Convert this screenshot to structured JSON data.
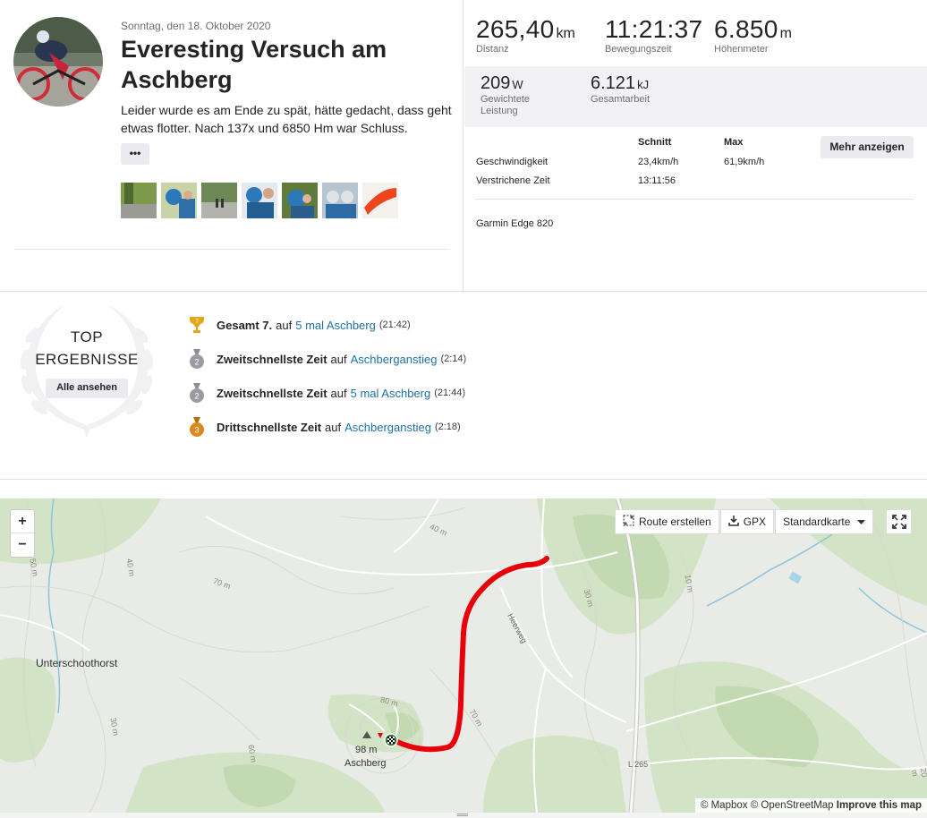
{
  "activity": {
    "date": "Sonntag, den 18. Oktober 2020",
    "title": "Everesting Versuch am Aschberg",
    "description": "Leider wurde es am Ende zu spät, hätte gedacht, dass geht etwas flotter. Nach 137x und 6850 Hm war Schluss.",
    "more_label": "•••",
    "photos": [
      "photo-1",
      "photo-2",
      "photo-3",
      "photo-4",
      "photo-5",
      "photo-6",
      "photo-7"
    ]
  },
  "stats": {
    "primary": [
      {
        "value": "265,40",
        "unit": "km",
        "label": "Distanz"
      },
      {
        "value": "11:21:37",
        "unit": "",
        "label": "Bewegungszeit"
      },
      {
        "value": "6.850",
        "unit": "m",
        "label": "Höhenmeter"
      }
    ],
    "secondary": [
      {
        "value": "209",
        "unit": "W",
        "label_1": "Gewichtete",
        "label_2": "Leistung"
      },
      {
        "value": "6.121",
        "unit": "kJ",
        "label_1": "Gesamtarbeit",
        "label_2": ""
      }
    ],
    "more_button": "Mehr anzeigen",
    "table": {
      "col_avg": "Schnitt",
      "col_max": "Max",
      "rows": [
        {
          "label": "Geschwindigkeit",
          "avg": "23,4km/h",
          "max": "61,9km/h"
        },
        {
          "label": "Verstrichene Zeit",
          "avg": "13:11:56",
          "max": ""
        }
      ]
    },
    "device": "Garmin Edge 820"
  },
  "achievements": {
    "badge_line1": "TOP",
    "badge_line2": "ERGEBNISSE",
    "all_button": "Alle ansehen",
    "items": [
      {
        "medal": "trophy-gold",
        "medal_text": "7",
        "bold": "Gesamt 7.",
        "connector": "auf",
        "segment": "5 mal Aschberg",
        "time": "(21:42)"
      },
      {
        "medal": "medal-silver",
        "medal_text": "2",
        "bold": "Zweitschnellste Zeit",
        "connector": "auf",
        "segment": "Aschberganstieg",
        "time": "(2:14)"
      },
      {
        "medal": "medal-silver",
        "medal_text": "2",
        "bold": "Zweitschnellste Zeit",
        "connector": "auf",
        "segment": "5 mal Aschberg",
        "time": "(21:44)"
      },
      {
        "medal": "medal-bronze",
        "medal_text": "3",
        "bold": "Drittschnellste Zeit",
        "connector": "auf",
        "segment": "Aschberganstieg",
        "time": "(2:18)"
      }
    ]
  },
  "map": {
    "zoom_in": "+",
    "zoom_out": "−",
    "route_button": "Route erstellen",
    "gpx_button": "GPX",
    "style_select": "Standardkarte",
    "place_label": "Unterschoothorst",
    "summit_height": "98 m",
    "summit_name": "Aschberg",
    "road_label": "Heerweg",
    "road_number": "L 265",
    "contours": [
      "40 m",
      "70 m",
      "50 m",
      "40 m",
      "30 m",
      "60 m",
      "80 m",
      "70 m",
      "30 m",
      "10 m",
      "20 m"
    ],
    "attribution_mapbox": "© Mapbox",
    "attribution_osm": "© OpenStreetMap",
    "attribution_improve": "Improve this map",
    "route_color": "#e8000b",
    "accent": "#fc4c02"
  }
}
